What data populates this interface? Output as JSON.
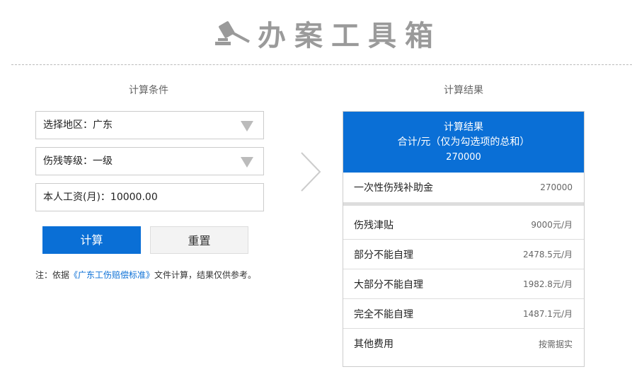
{
  "logo": {
    "text": "办案工具箱",
    "icon": "gavel-icon"
  },
  "left": {
    "title": "计算条件",
    "region": "选择地区：广东",
    "level": "伤残等级：一级",
    "salary": "本人工资(月)：10000.00",
    "calc_button": "计算",
    "reset_button": "重置",
    "note_prefix": "注：依据",
    "note_link": "《广东工伤赔偿标准》",
    "note_suffix": "文件计算，结果仅供参考。"
  },
  "right": {
    "title": "计算结果",
    "header_title": "计算结果",
    "header_sub": "合计/元（仅为勾选项的总和）",
    "header_total": "270000",
    "first": {
      "label": "一次性伤残补助金",
      "value": "270000"
    },
    "rows": [
      {
        "label": "伤残津贴",
        "value": "9000元/月"
      },
      {
        "label": "部分不能自理",
        "value": "2478.5元/月"
      },
      {
        "label": "大部分不能自理",
        "value": "1982.8元/月"
      },
      {
        "label": "完全不能自理",
        "value": "1487.1元/月"
      },
      {
        "label": "其他费用",
        "value": "按需据实"
      }
    ]
  },
  "colors": {
    "accent": "#0a6fd6"
  }
}
